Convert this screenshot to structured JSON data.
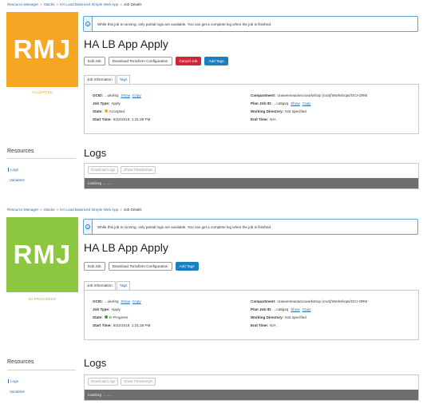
{
  "colors": {
    "accepted": "#f5a623",
    "in_progress": "#8dc63f",
    "link": "#2b6cb0",
    "cancel": "#d0263a",
    "primary": "#1a7fc1"
  },
  "panels": [
    {
      "breadcrumb": [
        "Resource Manager",
        "Stacks",
        "HA Load Balanced Simple Web App",
        "Job Details"
      ],
      "logo_text": "RMJ",
      "logo_color": "#f5a623",
      "state_label": "ACCEPTED",
      "notice": "While this job is running, only partial logs are available. You can get a complete log when the job is finished.",
      "title": "HA LB App Apply",
      "buttons": [
        "Edit Job",
        "Download Terraform Configuration",
        "Cancel Job",
        "Add Tags"
      ],
      "tabs": [
        "Job Information",
        "Tags"
      ],
      "info": {
        "ocid_label": "OCID:",
        "ocid_value": "...ukvf4q",
        "show": "Show",
        "copy": "Copy",
        "job_type_label": "Job Type:",
        "job_type_value": "Apply",
        "state_label": "State:",
        "state_value": "Accepted",
        "start_label": "Start Time:",
        "start_value": "8/22/2019, 1:31:38 PM",
        "compartment_label": "Compartment:",
        "compartment_value": "oraseemeaoseccworkshop (root)/Workshops/OCI-ORM",
        "plan_label": "Plan Job ID:",
        "plan_value": "...ca5gvq",
        "workdir_label": "Working Directory:",
        "workdir_value": "Not specified",
        "end_label": "End Time:",
        "end_value": "N/A"
      },
      "resources": {
        "heading": "Resources",
        "items": [
          "Logs",
          "Variables"
        ]
      },
      "logs": {
        "title": "Logs",
        "download": "Download Logs",
        "timestamps": "Show Timestamps",
        "loading": "Loading ....."
      }
    },
    {
      "breadcrumb": [
        "Resource Manager",
        "Stacks",
        "HA Load Balanced Simple Web App",
        "Job Details"
      ],
      "logo_text": "RMJ",
      "logo_color": "#8dc63f",
      "state_label": "IN PROGRESS",
      "notice": "While this job is running, only partial logs are available. You can get a complete log when the job is finished.",
      "title": "HA LB App Apply",
      "buttons": [
        "Edit Job",
        "Download Terraform Configuration",
        "Add Tags"
      ],
      "tabs": [
        "Job Information",
        "Tags"
      ],
      "info": {
        "ocid_label": "OCID:",
        "ocid_value": "...ukvf4q",
        "show": "Show",
        "copy": "Copy",
        "job_type_label": "Job Type:",
        "job_type_value": "Apply",
        "state_label": "State:",
        "state_value": "In Progress",
        "start_label": "Start Time:",
        "start_value": "8/22/2019, 1:31:38 PM",
        "compartment_label": "Compartment:",
        "compartment_value": "oraseemeaoseccworkshop (root)/Workshops/OCI-ORM",
        "plan_label": "Plan Job ID:",
        "plan_value": "...ca5gvq",
        "workdir_label": "Working Directory:",
        "workdir_value": "Not specified",
        "end_label": "End Time:",
        "end_value": "N/A"
      },
      "resources": {
        "heading": "Resources",
        "items": [
          "Logs",
          "Variables"
        ]
      },
      "logs": {
        "title": "Logs",
        "download": "Download Logs",
        "timestamps": "Show Timestamps",
        "loading": "Loading ....."
      }
    }
  ]
}
